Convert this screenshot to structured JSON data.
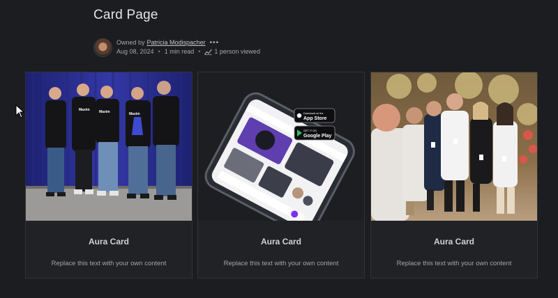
{
  "page": {
    "title": "Card Page"
  },
  "meta": {
    "owned_by_label": "Owned by",
    "owner_name": "Patricia Modispacher",
    "date": "Aug 08, 2024",
    "read_time": "1 min read",
    "views": "1 person viewed"
  },
  "cards": [
    {
      "title": "Aura Card",
      "body": "Replace this text with your own content",
      "image_icon": "team-photo-stage"
    },
    {
      "title": "Aura Card",
      "body": "Replace this text with your own content",
      "image_icon": "phone-app-mockup",
      "badges": {
        "app_store_small": "Download on the",
        "app_store_big": "App Store",
        "google_play_small": "GET IT ON",
        "google_play_big": "Google Play"
      }
    },
    {
      "title": "Aura Card",
      "body": "Replace this text with your own content",
      "image_icon": "group-selfie-photo"
    }
  ],
  "colors": {
    "background": "#1b1d20",
    "card": "#202225",
    "stage_blue": "#2a2f8a",
    "accent_purple": "#7b2ff7"
  }
}
